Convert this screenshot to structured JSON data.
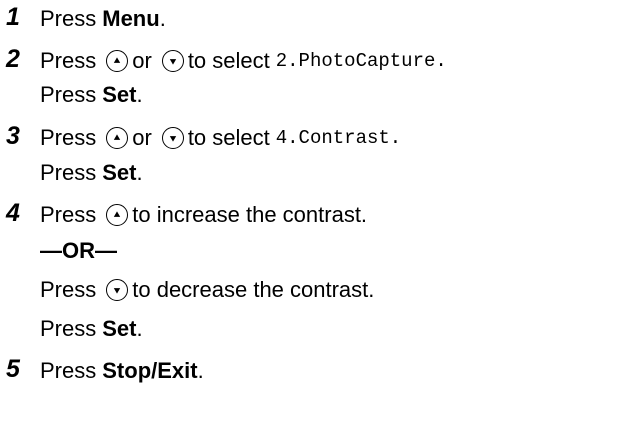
{
  "steps": [
    {
      "num": "1",
      "press": "Press",
      "key": "Menu",
      "end": "."
    },
    {
      "num": "2",
      "press": "Press",
      "or": "or",
      "to_select": "to select",
      "item": "2.PhotoCapture.",
      "press2": "Press",
      "set": "Set",
      "end2": "."
    },
    {
      "num": "3",
      "press": "Press",
      "or": "or",
      "to_select": "to select",
      "item": "4.Contrast.",
      "press2": "Press",
      "set": "Set",
      "end2": "."
    },
    {
      "num": "4",
      "press": "Press",
      "increase": "to increase the contrast.",
      "or_divider": "—OR—",
      "press2": "Press",
      "decrease": "to decrease the contrast.",
      "press3": "Press",
      "set": "Set",
      "end3": "."
    },
    {
      "num": "5",
      "press": "Press",
      "key": "Stop/Exit",
      "end": "."
    }
  ],
  "icons": {
    "up": "up-arrow-key-icon",
    "down": "down-arrow-key-icon"
  }
}
